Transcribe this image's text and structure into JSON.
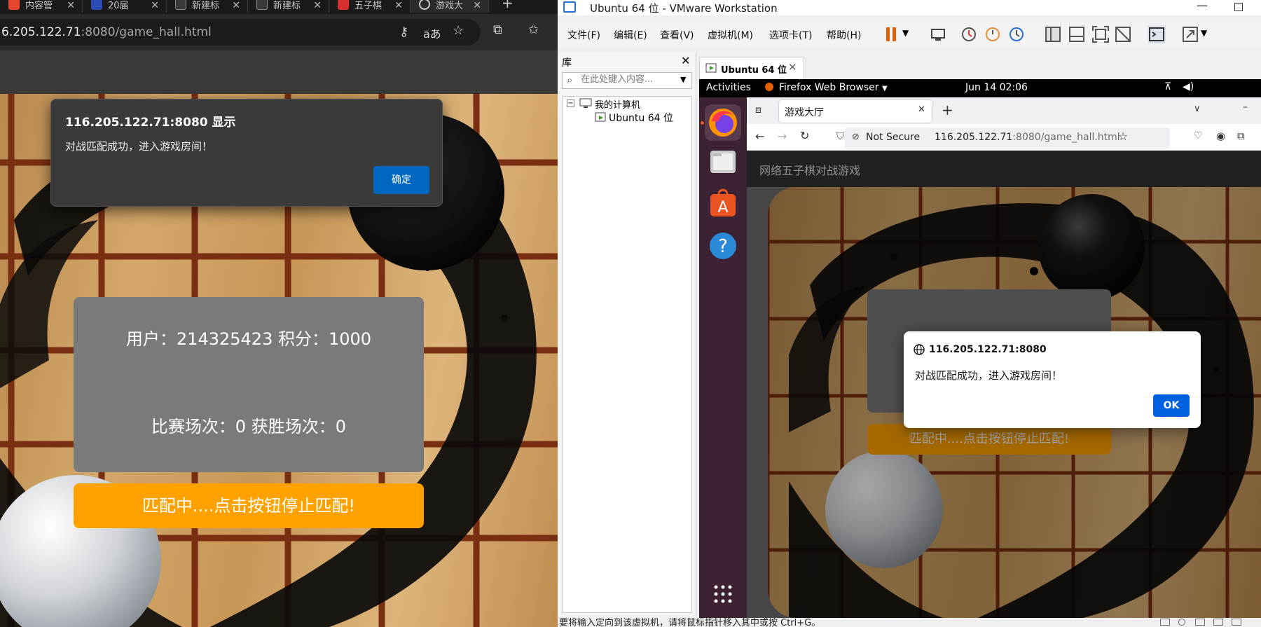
{
  "edge": {
    "tabs": [
      {
        "label": "内容管",
        "color": "#e8462c"
      },
      {
        "label": "20届",
        "color": "#2b4db5"
      },
      {
        "label": "新建标",
        "color": "#555555"
      },
      {
        "label": "新建标",
        "color": "#555555"
      },
      {
        "label": "五子棋",
        "color": "#d83030"
      },
      {
        "label": "游戏大",
        "color": "#777777"
      }
    ],
    "url_host": "6.205.122.71",
    "url_rest": ":8080/game_hall.html",
    "dialog": {
      "title": "116.205.122.71:8080 显示",
      "message": "对战匹配成功，进入游戏房间！",
      "ok": "确定"
    },
    "card": {
      "line1": "用户：214325423 积分：1000",
      "line2": "比赛场次：0 获胜场次：0"
    },
    "match_button": "匹配中....点击按钮停止匹配!"
  },
  "vmware": {
    "title": "Ubuntu 64 位 - VMware Workstation",
    "menu": [
      "文件(F)",
      "编辑(E)",
      "查看(V)",
      "虚拟机(M)",
      "选项卡(T)",
      "帮助(H)"
    ],
    "library": {
      "header": "库",
      "search_placeholder": "在此处键入内容...",
      "tree_root": "我的计算机",
      "tree_child": "Ubuntu 64 位"
    },
    "tab_label": "Ubuntu 64 位",
    "status_text": "要将输入定向到该虚拟机，请将鼠标指针移入其中或按 Ctrl+G。"
  },
  "ubuntu": {
    "activities": "Activities",
    "app_name": "Firefox Web Browser",
    "clock": "Jun 14  02:06",
    "firefox": {
      "tab_title": "游戏大厅",
      "not_secure": "Not Secure",
      "url_host": "116.205.122.71",
      "url_rest": ":8080/game_hall.html",
      "page_header": "网络五子棋对战游戏",
      "match_button": "匹配中....点击按钮停止匹配!",
      "dialog": {
        "title": "116.205.122.71:8080",
        "message": "对战匹配成功，进入游戏房间！",
        "ok": "OK"
      }
    }
  },
  "colors": {
    "match_orange": "#ffa200",
    "edge_ok_blue": "#0067c0",
    "firefox_ok_blue": "#0061e0",
    "card_gray": "#7a7a7a",
    "board_line": "#7a2e12"
  }
}
